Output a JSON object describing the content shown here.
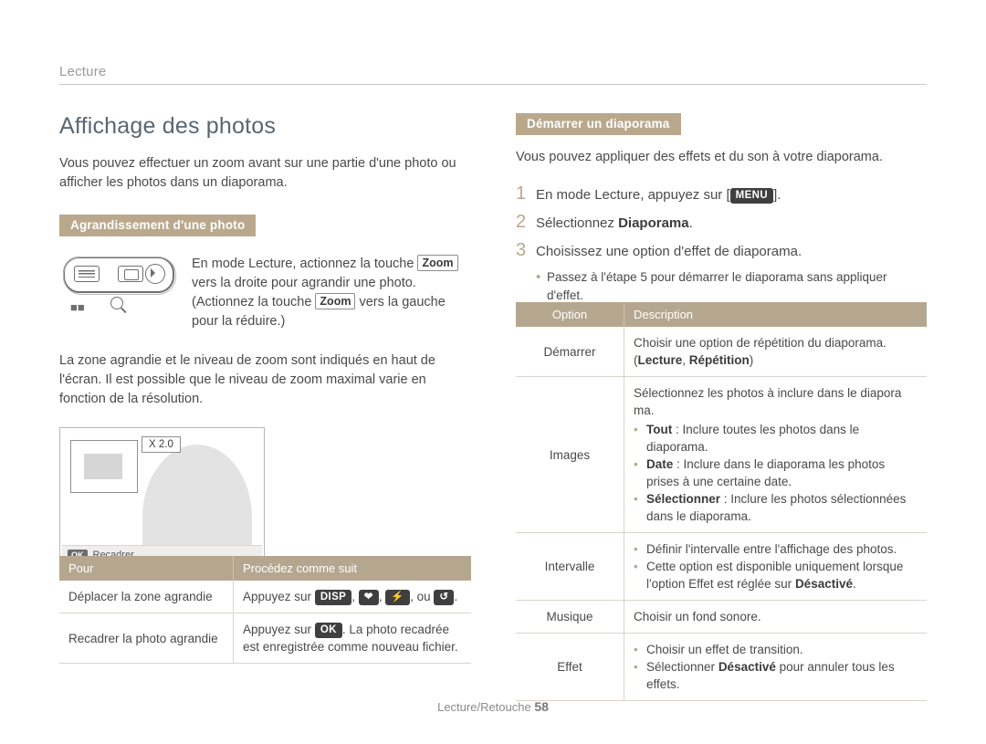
{
  "header": {
    "chapter": "Lecture"
  },
  "left": {
    "title": "Affichage des photos",
    "intro": "Vous pouvez effectuer un zoom avant sur une partie d'une photo ou afficher les photos dans un diaporama.",
    "subhead": "Agrandissement d'une photo",
    "fig_text_1": "En mode Lecture, actionnez la touche",
    "fig_key_zoom": "Zoom",
    "fig_text_2": "vers la droite pour agrandir une photo. (Actionnez la touche",
    "fig_text_3": "vers la gauche pour la réduire.)",
    "para2": "La zone agrandie et le niveau de zoom sont indiqués en haut de l'écran. Il est possible que le niveau de zoom maximal varie en fonction de la résolution.",
    "photo": {
      "zoom_label": "X 2.0",
      "ok_badge": "OK",
      "bottom_text": "Recadrer"
    },
    "table": {
      "headers": [
        "Pour",
        "Procédez comme suit"
      ],
      "rows": [
        {
          "label": "Déplacer la zone agrandie",
          "prefix": "Appuyez sur",
          "keys": [
            "DISP",
            "❤",
            "⚡",
            "ou",
            "↺"
          ],
          "suffix": "."
        },
        {
          "label": "Recadrer la photo agrandie",
          "prefix": "Appuyez sur",
          "key": "OK",
          "suffix": ". La photo recadrée est enregistrée comme nouveau fichier."
        }
      ]
    }
  },
  "right": {
    "subhead": "Démarrer un diaporama",
    "intro": "Vous pouvez appliquer des effets et du son à votre diaporama.",
    "steps": [
      {
        "num": "1",
        "pre": "En mode Lecture, appuyez sur [",
        "key": "MENU",
        "post": "]."
      },
      {
        "num": "2",
        "pre": "Sélectionnez ",
        "bold": "Diaporama",
        "post": "."
      },
      {
        "num": "3",
        "pre": "Choisissez une option d'effet de diaporama.",
        "bold": "",
        "post": ""
      }
    ],
    "step3_bullet": "Passez à l'étape 5 pour démarrer le diaporama sans appliquer d'effet.",
    "table": {
      "headers": [
        "Option",
        "Description"
      ],
      "rows": [
        {
          "option": "Démarrer",
          "lines": [
            {
              "type": "plain",
              "text": "Choisir une option de répétition du diaporama."
            },
            {
              "type": "plain_mixed",
              "pre": "(",
              "bold": "Lecture",
              "mid": ", ",
              "bold2": "Répétition",
              "post": ")"
            }
          ]
        },
        {
          "option": "Images",
          "lines": [
            {
              "type": "plain",
              "text": "Sélectionnez les photos à inclure dans le diapora ma."
            },
            {
              "type": "bullet",
              "bold": "Tout",
              "text": " : Inclure toutes les photos dans le diaporama."
            },
            {
              "type": "bullet",
              "bold": "Date",
              "text": " : Inclure dans le diaporama les photos prises à une certaine date."
            },
            {
              "type": "bullet",
              "bold": "Sélectionner",
              "text": " : Inclure les photos sélectionnées dans le diaporama."
            }
          ]
        },
        {
          "option": "Intervalle",
          "lines": [
            {
              "type": "bullet",
              "bold": "",
              "text": "Définir l'intervalle entre l'affichage des photos."
            },
            {
              "type": "bullet_tail",
              "pre": "Cette option est disponible uniquement lorsque l'option Effet est réglée sur ",
              "bold": "Désactivé",
              "post": "."
            }
          ]
        },
        {
          "option": "Musique",
          "lines": [
            {
              "type": "plain",
              "text": "Choisir un fond sonore."
            }
          ]
        },
        {
          "option": "Effet",
          "lines": [
            {
              "type": "bullet",
              "bold": "",
              "text": "Choisir un effet de transition."
            },
            {
              "type": "bullet_mid",
              "pre": "Sélectionner ",
              "bold": "Désactivé",
              "post": " pour annuler tous les effets."
            }
          ]
        }
      ]
    }
  },
  "footer": {
    "text": "Lecture/Retouche ",
    "page": "58"
  }
}
